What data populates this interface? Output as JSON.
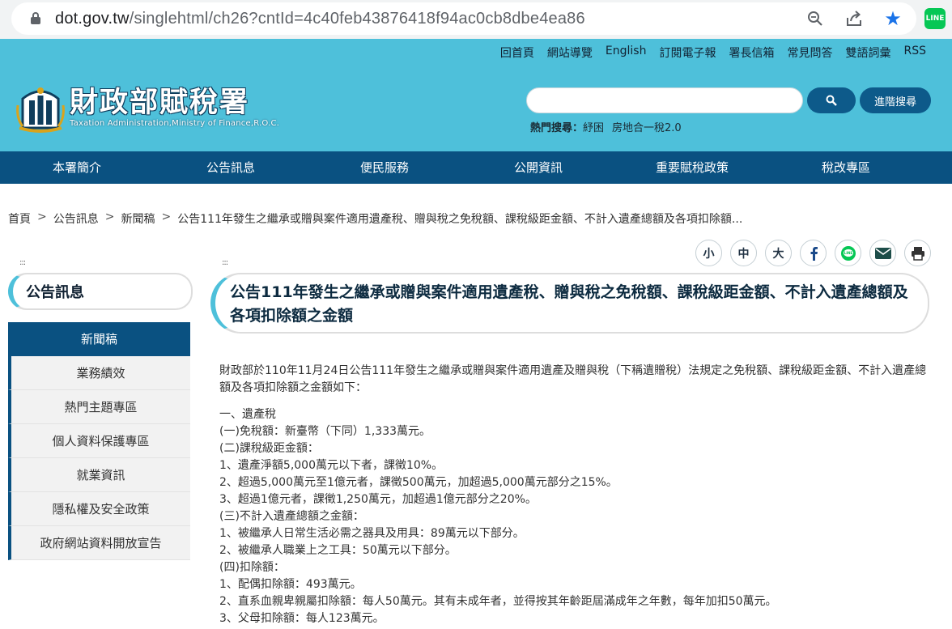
{
  "browser": {
    "url_host": "dot.gov.tw",
    "url_path": "/singlehtml/ch26?cntId=4c40feb43876418f94ac0cb8dbe4ea86"
  },
  "header": {
    "top_links": [
      "回首頁",
      "網站導覽",
      "English",
      "訂閱電子報",
      "署長信箱",
      "常見問答",
      "雙語詞彙",
      "RSS"
    ],
    "logo_zh": "財政部賦稅署",
    "logo_en": "Taxation Administration,Ministry of Finance,R.O.C.",
    "search_placeholder": "",
    "advanced_search": "進階搜尋",
    "hot_label": "熱門搜尋：",
    "hot_terms": [
      "紓困",
      "房地合一稅2.0"
    ]
  },
  "nav": [
    "本署簡介",
    "公告訊息",
    "便民服務",
    "公開資訊",
    "重要賦稅政策",
    "稅改專區"
  ],
  "breadcrumb": [
    "首頁",
    "公告訊息",
    "新聞稿",
    "公告111年發生之繼承或贈與案件適用遺產稅、贈與稅之免稅額、課稅級距金額、不計入遺產總額及各項扣除額..."
  ],
  "tools": [
    "小",
    "中",
    "大"
  ],
  "accesskey": ":::",
  "sidebar": {
    "title": "公告訊息",
    "active": "新聞稿",
    "items": [
      "業務績效",
      "熱門主題專區",
      "個人資料保護專區",
      "就業資訊",
      "隱私權及安全政策",
      "政府網站資料開放宣告"
    ]
  },
  "article": {
    "title": "公告111年發生之繼承或贈與案件適用遺產稅、贈與稅之免稅額、課稅級距金額、不計入遺產總額及各項扣除額之金額",
    "intro": "財政部於110年11月24日公告111年發生之繼承或贈與案件適用遺產及贈與稅（下稱遺贈稅）法規定之免稅額、課稅級距金額、不計入遺產總額及各項扣除額之金額如下：",
    "lines": [
      "一、遺產稅",
      "(一)免稅額：新臺幣（下同）1,333萬元。",
      "(二)課稅級距金額：",
      "1、遺產淨額5,000萬元以下者，課徵10%。",
      "2、超過5,000萬元至1億元者，課徵500萬元，加超過5,000萬元部分之15%。",
      "3、超過1億元者，課徵1,250萬元，加超過1億元部分之20%。",
      "(三)不計入遺產總額之金額：",
      "1、被繼承人日常生活必需之器具及用具：89萬元以下部分。",
      "2、被繼承人職業上之工具：50萬元以下部分。",
      "(四)扣除額：",
      "1、配偶扣除額：493萬元。",
      "2、直系血親卑親屬扣除額：每人50萬元。其有未成年者，並得按其年齡距屆滿成年之年數，每年加扣50萬元。",
      "3、父母扣除額：每人123萬元。"
    ]
  }
}
